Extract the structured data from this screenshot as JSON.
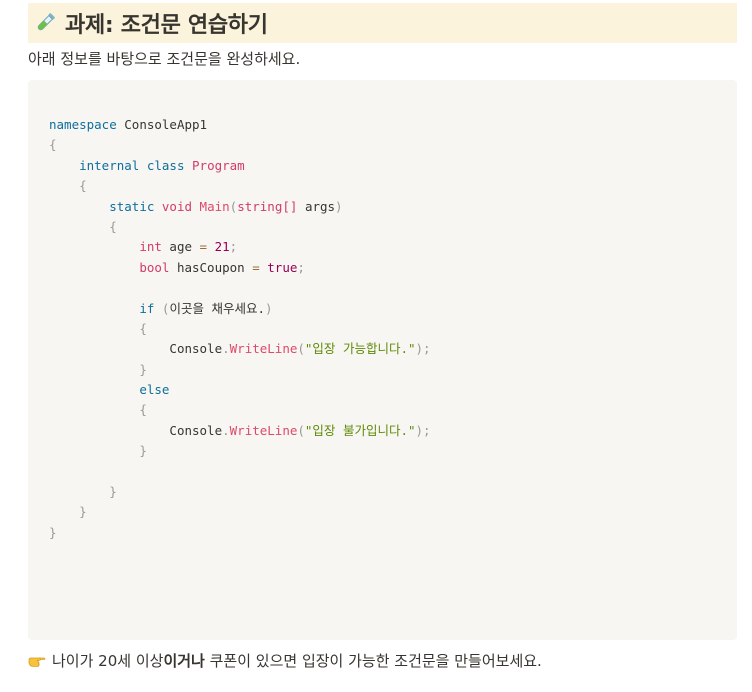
{
  "title": {
    "icon": "test-tube-icon",
    "text": "과제: 조건문 연습하기"
  },
  "subtitle": "아래 정보를 바탕으로 조건문을 완성하세요.",
  "code": {
    "namespace_kw": "namespace",
    "namespace_name": "ConsoleApp1",
    "internal_kw": "internal",
    "class_kw": "class",
    "class_name": "Program",
    "static_kw": "static",
    "void_kw": "void",
    "main_name": "Main",
    "param_type": "string[]",
    "param_name": "args",
    "int_kw": "int",
    "age_var": "age",
    "age_value": "21",
    "bool_kw": "bool",
    "coupon_var": "hasCoupon",
    "coupon_value": "true",
    "if_kw": "if",
    "if_placeholder": "이곳을 채우세요.",
    "console_1": "Console",
    "writeline_1": "WriteLine",
    "string_1": "\"입장 가능합니다.\"",
    "else_kw": "else",
    "console_2": "Console",
    "writeline_2": "WriteLine",
    "string_2": "\"입장 불가입니다.\""
  },
  "footer": {
    "icon": "pointing-hand-icon",
    "before": "나이가 20세 이상",
    "bold": "이거나",
    "after": " 쿠폰이 있으면 입장이 가능한 조건문을 만들어보세요."
  }
}
